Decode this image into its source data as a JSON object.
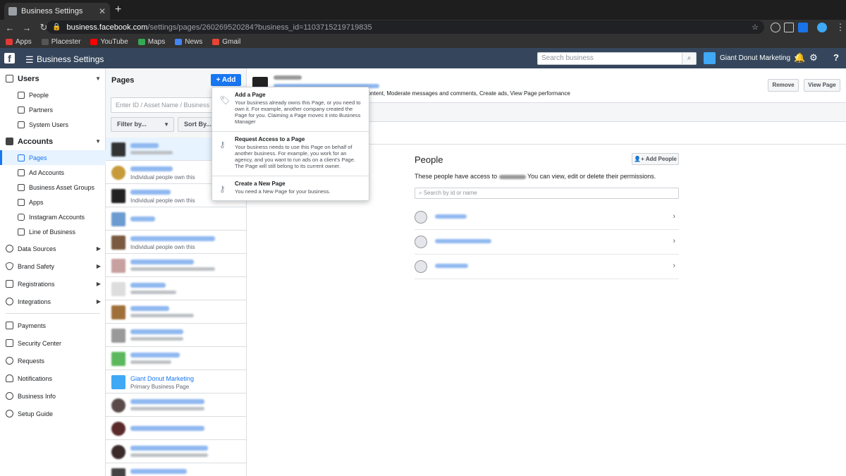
{
  "browser": {
    "tab_title": "Business Settings",
    "url_host": "business.facebook.com",
    "url_path": "/settings/pages/260269520284?business_id=1103715219719835",
    "bookmarks": [
      "Apps",
      "Placester",
      "YouTube",
      "Maps",
      "News",
      "Gmail"
    ]
  },
  "header": {
    "title": "Business Settings",
    "search_placeholder": "Search business",
    "business_name": "Giant Donut Marketing"
  },
  "nav": {
    "users": "Users",
    "people": "People",
    "partners": "Partners",
    "system_users": "System Users",
    "accounts": "Accounts",
    "pages": "Pages",
    "ad_accounts": "Ad Accounts",
    "asset_groups": "Business Asset Groups",
    "apps": "Apps",
    "instagram": "Instagram Accounts",
    "lob": "Line of Business",
    "data_sources": "Data Sources",
    "brand_safety": "Brand Safety",
    "registrations": "Registrations",
    "integrations": "Integrations",
    "payments": "Payments",
    "security": "Security Center",
    "requests": "Requests",
    "notifications": "Notifications",
    "business_info": "Business Info",
    "setup_guide": "Setup Guide"
  },
  "pages_col": {
    "title": "Pages",
    "add_label": "+ Add",
    "id_placeholder": "Enter ID / Asset Name / Business Name",
    "filter_label": "Filter by...",
    "sort_label": "Sort By...",
    "individual_sub": "Individual people own this",
    "gdm_name": "Giant Donut Marketing",
    "gdm_sub": "Primary Business Page"
  },
  "dropdown": {
    "add_title": "Add a Page",
    "add_desc": "Your business already owns this Page, or you need to own it. For example, another company created the Page for you. Claiming a Page moves it into Business Manager",
    "req_title": "Request Access to a Page",
    "req_desc": "Your business needs to use this Page on behalf of another business. For example, you work for an agency, and you want to run ads on a client's Page. The Page will still belong to its current owner.",
    "new_title": "Create a New Page",
    "new_desc": "You need a New Page for your business."
  },
  "main": {
    "permissions_fragment": "h content, Moderate messages and comments, Create ads, View Page performance",
    "remove_label": "Remove",
    "view_label": "View Page",
    "people_title": "People",
    "add_people_label": "Add People",
    "people_desc_pre": "These people have access to",
    "people_desc_post": "You can view, edit or delete their permissions.",
    "search_placeholder": "Search by id or name"
  }
}
